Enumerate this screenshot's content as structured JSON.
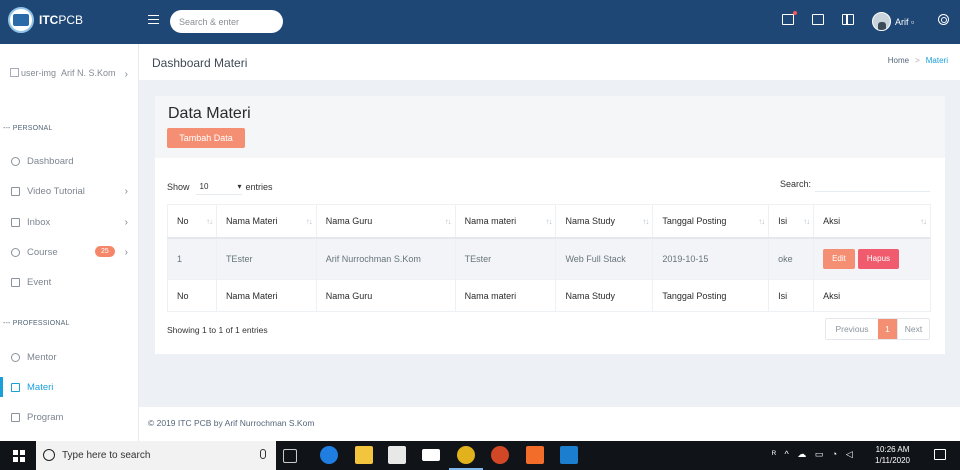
{
  "topbar": {
    "logo_text_bold": "ITC",
    "logo_text_rest": "PCB",
    "search_placeholder": "Search & enter",
    "user_name": "Arif",
    "user_caret": "▫"
  },
  "sidebar": {
    "user_image_alt": "user-img",
    "user_name": "Arif N. S.Kom",
    "sections": [
      "PERSONAL",
      "PROFESSIONAL"
    ],
    "section_prefix": "---",
    "items": [
      {
        "label": "Dashboard",
        "icon": "dashboard-icon"
      },
      {
        "label": "Video Tutorial",
        "icon": "video-icon"
      },
      {
        "label": "Inbox",
        "icon": "inbox-icon"
      },
      {
        "label": "Course",
        "icon": "course-icon",
        "badge": "25"
      },
      {
        "label": "Event",
        "icon": "calendar-icon"
      },
      {
        "label": "Mentor",
        "icon": "mentor-icon"
      },
      {
        "label": "Materi",
        "icon": "materi-icon",
        "active": true
      },
      {
        "label": "Program",
        "icon": "program-icon"
      }
    ]
  },
  "header": {
    "title": "Dashboard Materi",
    "breadcrumb": [
      "Home",
      "Materi"
    ]
  },
  "card": {
    "title": "Data Materi",
    "add_button": "Tambah Data",
    "show_label": "Show",
    "entries_value": "10",
    "entries_label": "entries",
    "search_label": "Search:",
    "columns": [
      "No",
      "Nama Materi",
      "Nama Guru",
      "Nama materi",
      "Nama Study",
      "Tanggal Posting",
      "Isi",
      "Aksi"
    ],
    "rows": [
      {
        "no": "1",
        "nama_materi": "TEster",
        "nama_guru": "Arif Nurrochman S.Kom",
        "nama_materi2": "TEster",
        "nama_study": "Web Full Stack",
        "tanggal": "2019-10-15",
        "isi": "oke"
      }
    ],
    "edit_label": "Edit",
    "delete_label": "Hapus",
    "info": "Showing 1 to 1 of 1 entries",
    "pagination": {
      "previous": "Previous",
      "current": "1",
      "next": "Next"
    }
  },
  "footer": {
    "text": "© 2019 ITC PCB by Arif Nurrochman S.Kom"
  },
  "taskbar": {
    "search_text": "Type here to search",
    "time": "10:26 AM",
    "date": "1/11/2020"
  },
  "colors": {
    "topbar": "#1e4776",
    "accent": "#1a9fdb",
    "button_orange": "#f58f73",
    "button_red": "#f05b6d"
  }
}
